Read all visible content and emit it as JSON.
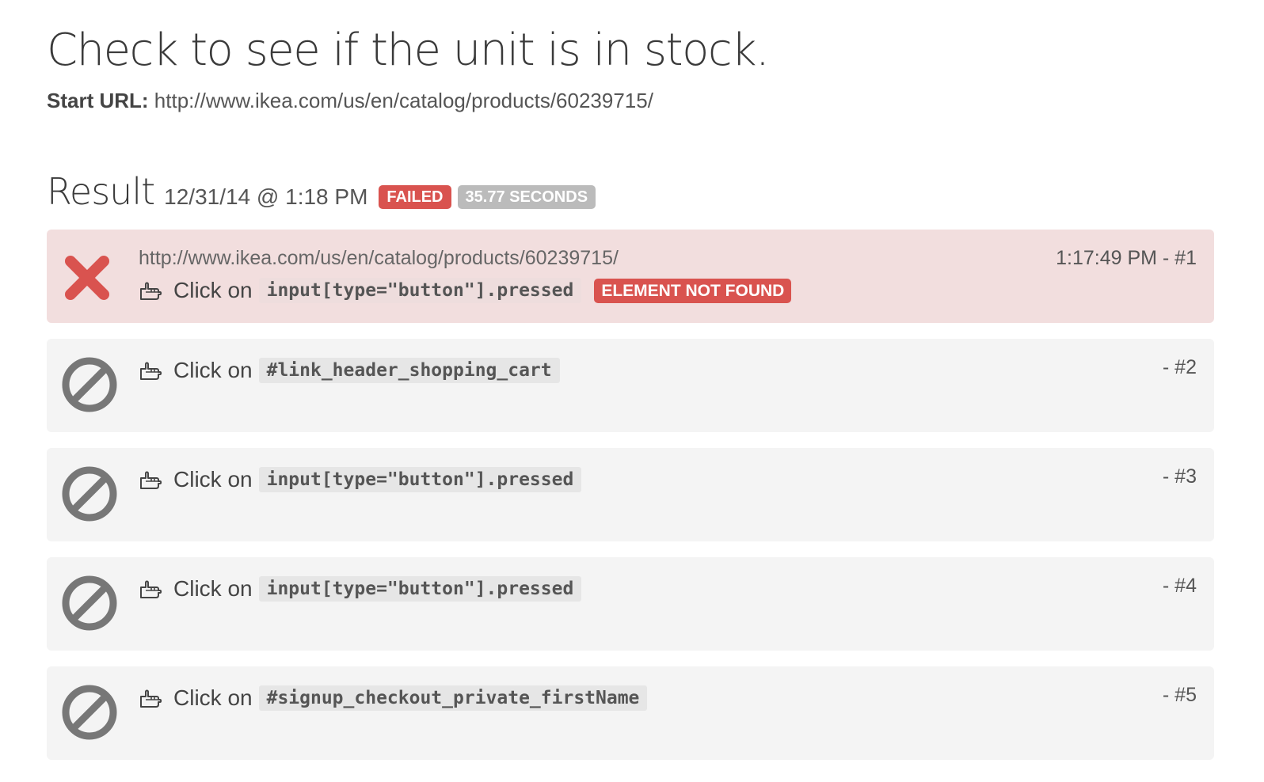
{
  "page": {
    "title": "Check to see if the unit is in stock.",
    "start_url_label": "Start URL:",
    "start_url": "http://www.ikea.com/us/en/catalog/products/60239715/"
  },
  "result": {
    "label": "Result",
    "datetime": "12/31/14 @ 1:18 PM",
    "status_badge": "FAILED",
    "duration_badge": "35.77 SECONDS",
    "colors": {
      "failed": "#d9534f",
      "duration": "#bbbbbb",
      "failed_row": "#f2dede",
      "skipped_row": "#f4f4f4"
    }
  },
  "steps": [
    {
      "status_icon": "close-x-icon",
      "url": "http://www.ikea.com/us/en/catalog/products/60239715/",
      "action_icon": "pointing-hand-icon",
      "action": "Click on",
      "selector": "input[type=\"button\"].pressed",
      "error": "ELEMENT NOT FOUND",
      "meta": "1:17:49 PM - #1"
    },
    {
      "status_icon": "prohibited-icon",
      "action_icon": "pointing-hand-icon",
      "action": "Click on",
      "selector": "#link_header_shopping_cart",
      "meta": "- #2"
    },
    {
      "status_icon": "prohibited-icon",
      "action_icon": "pointing-hand-icon",
      "action": "Click on",
      "selector": "input[type=\"button\"].pressed",
      "meta": "- #3"
    },
    {
      "status_icon": "prohibited-icon",
      "action_icon": "pointing-hand-icon",
      "action": "Click on",
      "selector": "input[type=\"button\"].pressed",
      "meta": "- #4"
    },
    {
      "status_icon": "prohibited-icon",
      "action_icon": "pointing-hand-icon",
      "action": "Click on",
      "selector": "#signup_checkout_private_firstName",
      "meta": "- #5"
    }
  ]
}
